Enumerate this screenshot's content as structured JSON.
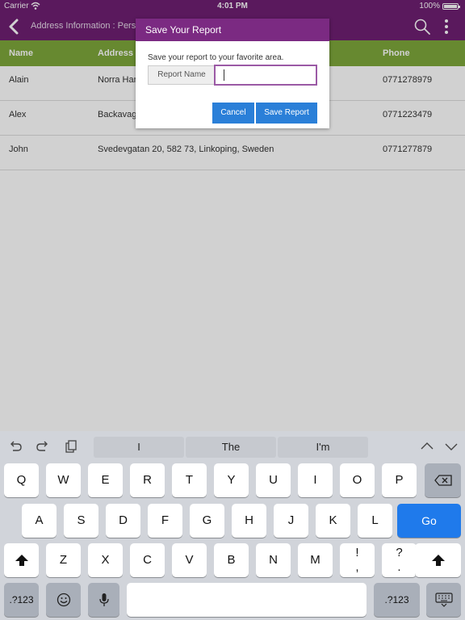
{
  "status": {
    "carrier": "Carrier",
    "time": "4:01 PM",
    "battery": "100%"
  },
  "appbar": {
    "title": "Address Information : Perso"
  },
  "table": {
    "headers": [
      "Name",
      "Address",
      "Phone"
    ],
    "rows": [
      {
        "name": "Alain",
        "address": "Norra Han",
        "phone": "0771278979"
      },
      {
        "name": "Alex",
        "address": "Backavage",
        "phone": "0771223479"
      },
      {
        "name": "John",
        "address": "Svedevgatan 20, 582 73, Linkoping, Sweden",
        "phone": "0771277879"
      }
    ]
  },
  "dialog": {
    "title": "Save Your Report",
    "message": "Save your report to your favorite area.",
    "label": "Report Name",
    "input_value": "",
    "cancel": "Cancel",
    "save": "Save Report"
  },
  "keyboard": {
    "suggestions": [
      "I",
      "The",
      "I'm"
    ],
    "row1": [
      "Q",
      "W",
      "E",
      "R",
      "T",
      "Y",
      "U",
      "I",
      "O",
      "P"
    ],
    "row2": [
      "A",
      "S",
      "D",
      "F",
      "G",
      "H",
      "J",
      "K",
      "L"
    ],
    "go": "Go",
    "row3": [
      "Z",
      "X",
      "C",
      "V",
      "B",
      "N",
      "M"
    ],
    "punct1": "!",
    "punct1b": ",",
    "punct2": "?",
    "punct2b": ".",
    "num": ".?123"
  },
  "colors": {
    "appbar": "#6e1f72",
    "header": "#7ea83b",
    "button": "#2a7fd8"
  }
}
